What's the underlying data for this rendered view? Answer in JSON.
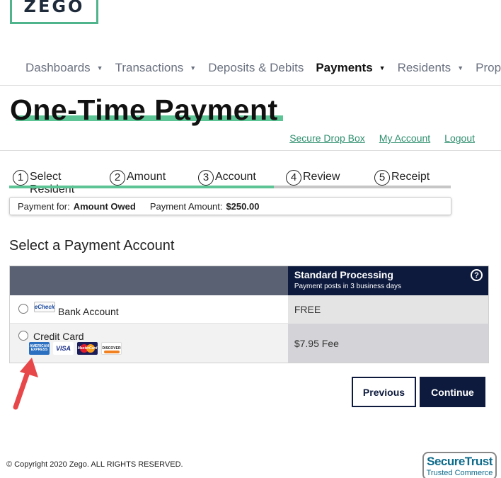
{
  "brand": {
    "logo_text": "ZEGO",
    "accent": "#5cc495",
    "dark": "#0d1a3d"
  },
  "nav": {
    "items": [
      {
        "label": "Dashboards",
        "caret": "▼"
      },
      {
        "label": "Transactions",
        "caret": "▼"
      },
      {
        "label": "Deposits & Debits",
        "caret": ""
      },
      {
        "label": "Payments",
        "caret": "▼",
        "active": true
      },
      {
        "label": "Residents",
        "caret": "▼"
      },
      {
        "label": "Prope",
        "caret": ""
      }
    ]
  },
  "page": {
    "title": "One-Time Payment"
  },
  "links": {
    "secure_drop_box": "Secure Drop Box",
    "my_account": "My Account",
    "logout": "Logout"
  },
  "steps": [
    {
      "num": "1",
      "label": "Select Resident"
    },
    {
      "num": "2",
      "label": "Amount"
    },
    {
      "num": "3",
      "label": "Account"
    },
    {
      "num": "4",
      "label": "Review"
    },
    {
      "num": "5",
      "label": "Receipt"
    }
  ],
  "summary": {
    "payment_for_label": "Payment for:",
    "payment_for_value": "Amount Owed",
    "payment_amount_label": "Payment Amount:",
    "payment_amount_value": "$250.00"
  },
  "section": {
    "title": "Select a Payment Account"
  },
  "table": {
    "header": {
      "title": "Standard Processing",
      "subtitle": "Payment posts in 3 business days",
      "help": "?"
    },
    "rows": [
      {
        "icon_text": "eCheck",
        "label": "Bank Account",
        "fee": "FREE"
      },
      {
        "label": "Credit Card",
        "fee": "$7.95 Fee"
      }
    ],
    "cards": {
      "amex": "AMERICAN EXPRESS",
      "visa": "VISA",
      "mastercard": "MasterCard",
      "discover": "DISCOVER"
    }
  },
  "buttons": {
    "previous": "Previous",
    "continue": "Continue"
  },
  "footer": {
    "copyright": "© Copyright 2020 Zego. ALL RIGHTS RESERVED.",
    "trust_title": "SecureTrust",
    "trust_subtitle": "Trusted Commerce"
  }
}
